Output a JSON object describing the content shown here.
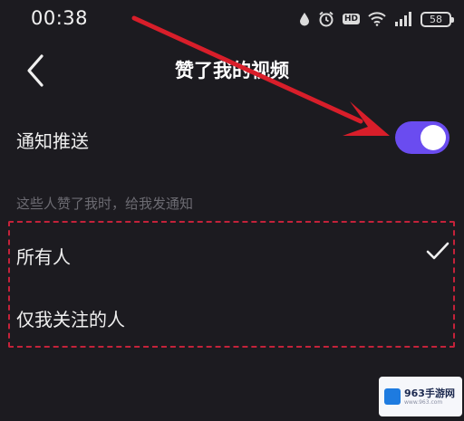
{
  "status_bar": {
    "time": "00:38",
    "battery": "58",
    "hd": "HD"
  },
  "header": {
    "title": "赞了我的视频"
  },
  "notification": {
    "label": "通知推送",
    "enabled": true
  },
  "audience": {
    "hint": "这些人赞了我时，给我发通知",
    "options": [
      {
        "label": "所有人",
        "selected": true
      },
      {
        "label": "仅我关注的人",
        "selected": false
      }
    ]
  },
  "watermark": {
    "brand": "963手游网",
    "url": "www.963.com"
  },
  "colors": {
    "background": "#1c1b20",
    "toggle_on": "#6a4cf0",
    "highlight": "#c4223a",
    "arrow": "#d81e2a"
  }
}
